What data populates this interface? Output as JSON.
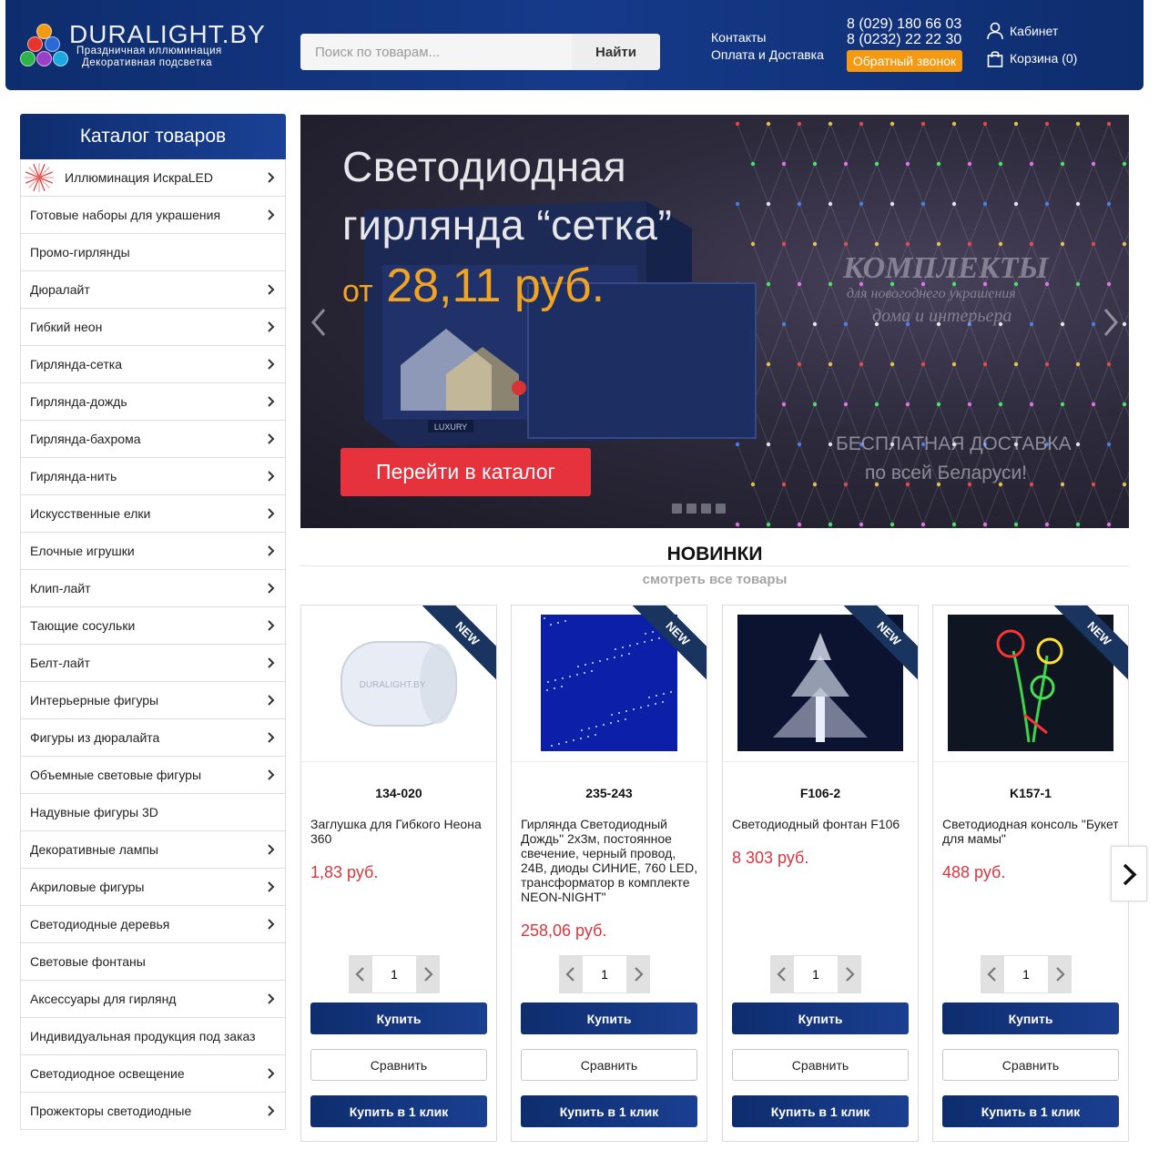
{
  "header": {
    "logo_title": "DURALIGHT.BY",
    "logo_sub1": "Праздничная иллюминация",
    "logo_sub2": "Декоративная подсветка",
    "search_placeholder": "Поиск по товарам...",
    "search_button": "Найти",
    "links": [
      "Контакты",
      "Оплата и Доставка"
    ],
    "phones": [
      "8 (029) 180 66 03",
      "8 (0232) 22 22 30"
    ],
    "callback": "Обратный звонок",
    "cabinet": "Кабинет",
    "cart": "Корзина (0)"
  },
  "sidebar": {
    "title": "Каталог товаров",
    "items": [
      {
        "label": "Иллюминация ИскраLED",
        "chevron": true
      },
      {
        "label": "Готовые наборы для украшения",
        "chevron": true
      },
      {
        "label": "Промо-гирлянды",
        "chevron": false
      },
      {
        "label": "Дюралайт",
        "chevron": true
      },
      {
        "label": "Гибкий неон",
        "chevron": true
      },
      {
        "label": "Гирлянда-сетка",
        "chevron": true
      },
      {
        "label": "Гирлянда-дождь",
        "chevron": true
      },
      {
        "label": "Гирлянда-бахрома",
        "chevron": true
      },
      {
        "label": "Гирлянда-нить",
        "chevron": true
      },
      {
        "label": "Искусственные елки",
        "chevron": true
      },
      {
        "label": "Елочные игрушки",
        "chevron": true
      },
      {
        "label": "Клип-лайт",
        "chevron": true
      },
      {
        "label": "Тающие сосульки",
        "chevron": true
      },
      {
        "label": "Белт-лайт",
        "chevron": true
      },
      {
        "label": "Интерьерные фигуры",
        "chevron": true
      },
      {
        "label": "Фигуры из дюралайта",
        "chevron": true
      },
      {
        "label": "Объемные световые фигуры",
        "chevron": true
      },
      {
        "label": "Надувные фигуры 3D",
        "chevron": false
      },
      {
        "label": "Декоративные лампы",
        "chevron": true
      },
      {
        "label": "Акриловые фигуры",
        "chevron": true
      },
      {
        "label": "Светодиодные деревья",
        "chevron": true
      },
      {
        "label": "Световые фонтаны",
        "chevron": false
      },
      {
        "label": "Аксессуары для гирлянд",
        "chevron": true
      },
      {
        "label": "Индивидуальная продукция под заказ",
        "chevron": false
      },
      {
        "label": "Светодиодное освещение",
        "chevron": true
      },
      {
        "label": "Прожекторы светодиодные",
        "chevron": true
      }
    ]
  },
  "banner": {
    "line1": "Светодиодная",
    "line2": "гирлянда “сетка”",
    "price_prefix": "от",
    "price": "28,11 руб.",
    "button": "Перейти в каталог",
    "watermark1": "КОМПЛЕКТЫ",
    "watermark2": "для новогоднего украшения",
    "watermark3": "дома и интерьера",
    "free1": "БЕСПЛАТНАЯ ДОСТАВКА",
    "free2": "по всей Беларуси!",
    "box_label": "LUXURY"
  },
  "new_section": {
    "title": "НОВИНКИ",
    "subtitle": "смотреть все товары"
  },
  "products": [
    {
      "sku": "134-020",
      "name": "Заглушка для Гибкого Неона 360",
      "price": "1,83 руб.",
      "qty": "1",
      "ribbon": "NEW",
      "img_text": "DURALIGHT.BY"
    },
    {
      "sku": "235-243",
      "name": "Гирлянда Светодиодный Дождь\" 2х3м, постоянное свечение, черный провод, 24В, диоды СИНИЕ, 760 LED, трансформатор в комплекте NEON-NIGHT\"",
      "price": "258,06 руб.",
      "qty": "1",
      "ribbon": "NEW"
    },
    {
      "sku": "F106-2",
      "name": "Светодиодный фонтан F106",
      "price": "8 303 руб.",
      "qty": "1",
      "ribbon": "NEW"
    },
    {
      "sku": "K157-1",
      "name": "Светодиодная консоль \"Букет для мамы\"",
      "price": "488 руб.",
      "qty": "1",
      "ribbon": "NEW"
    }
  ],
  "buttons": {
    "buy": "Купить",
    "compare": "Сравнить",
    "one_click": "Купить в 1 клик"
  },
  "colors": {
    "brand_navy": "#0e2d6e",
    "accent_orange": "#f39a12",
    "banner_red": "#e6323d",
    "price_red": "#d9363e",
    "banner_gold": "#f1a422"
  }
}
